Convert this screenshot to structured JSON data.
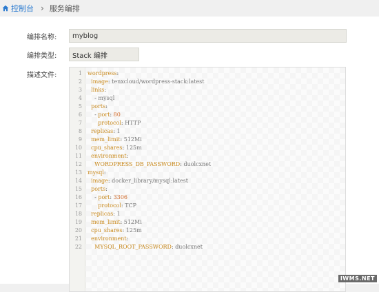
{
  "breadcrumb": {
    "home": "控制台",
    "separator": "›",
    "current": "服务编排",
    "home_icon": "home-icon"
  },
  "form": {
    "name_label": "编排名称:",
    "name_value": "myblog",
    "type_label": "编排类型:",
    "type_value": "Stack 编排",
    "file_label": "描述文件:"
  },
  "editor": {
    "lines": [
      [
        [
          "k",
          "wordpress"
        ],
        [
          "p",
          ":"
        ]
      ],
      [
        [
          "p",
          "  "
        ],
        [
          "k",
          "image"
        ],
        [
          "p",
          ": "
        ],
        [
          "v",
          "tenxcloud/wordpress-stack:latest"
        ]
      ],
      [
        [
          "p",
          "  "
        ],
        [
          "k",
          "links"
        ],
        [
          "p",
          ":"
        ]
      ],
      [
        [
          "p",
          "    - "
        ],
        [
          "v",
          "mysql"
        ]
      ],
      [
        [
          "p",
          "  "
        ],
        [
          "k",
          "ports"
        ],
        [
          "p",
          ":"
        ]
      ],
      [
        [
          "p",
          "    - "
        ],
        [
          "k",
          "port"
        ],
        [
          "p",
          ": "
        ],
        [
          "n",
          "80"
        ]
      ],
      [
        [
          "p",
          "      "
        ],
        [
          "k",
          "protocol"
        ],
        [
          "p",
          ": "
        ],
        [
          "v",
          "HTTP"
        ]
      ],
      [
        [
          "p",
          "  "
        ],
        [
          "k",
          "replicas"
        ],
        [
          "p",
          ": "
        ],
        [
          "v",
          "1"
        ]
      ],
      [
        [
          "p",
          "  "
        ],
        [
          "k",
          "mem_limit"
        ],
        [
          "p",
          ": "
        ],
        [
          "v",
          "512Mi"
        ]
      ],
      [
        [
          "p",
          "  "
        ],
        [
          "k",
          "cpu_shares"
        ],
        [
          "p",
          ": "
        ],
        [
          "v",
          "125m"
        ]
      ],
      [
        [
          "p",
          "  "
        ],
        [
          "k",
          "environment"
        ],
        [
          "p",
          ":"
        ]
      ],
      [
        [
          "p",
          "    "
        ],
        [
          "k",
          "WORDPRESS_DB_PASSWORD"
        ],
        [
          "p",
          ": "
        ],
        [
          "v",
          "duolcxnet"
        ]
      ],
      [
        [
          "k",
          "mysql"
        ],
        [
          "p",
          ":"
        ]
      ],
      [
        [
          "p",
          "  "
        ],
        [
          "k",
          "image"
        ],
        [
          "p",
          ": "
        ],
        [
          "v",
          "docker_library/mysql:latest"
        ]
      ],
      [
        [
          "p",
          "  "
        ],
        [
          "k",
          "ports"
        ],
        [
          "p",
          ":"
        ]
      ],
      [
        [
          "p",
          "    - "
        ],
        [
          "k",
          "port"
        ],
        [
          "p",
          ": "
        ],
        [
          "n",
          "3306"
        ]
      ],
      [
        [
          "p",
          "      "
        ],
        [
          "k",
          "protocol"
        ],
        [
          "p",
          ": "
        ],
        [
          "v",
          "TCP"
        ]
      ],
      [
        [
          "p",
          "  "
        ],
        [
          "k",
          "replicas"
        ],
        [
          "p",
          ": "
        ],
        [
          "v",
          "1"
        ]
      ],
      [
        [
          "p",
          "  "
        ],
        [
          "k",
          "mem_limit"
        ],
        [
          "p",
          ": "
        ],
        [
          "v",
          "512Mi"
        ]
      ],
      [
        [
          "p",
          "  "
        ],
        [
          "k",
          "cpu_shares"
        ],
        [
          "p",
          ": "
        ],
        [
          "v",
          "125m"
        ]
      ],
      [
        [
          "p",
          "  "
        ],
        [
          "k",
          "environment"
        ],
        [
          "p",
          ":"
        ]
      ],
      [
        [
          "p",
          "    "
        ],
        [
          "k",
          "MYSQL_ROOT_PASSWORD"
        ],
        [
          "p",
          ": "
        ],
        [
          "v",
          "duolcxnet"
        ]
      ]
    ]
  },
  "watermark": "IWMS.NET"
}
